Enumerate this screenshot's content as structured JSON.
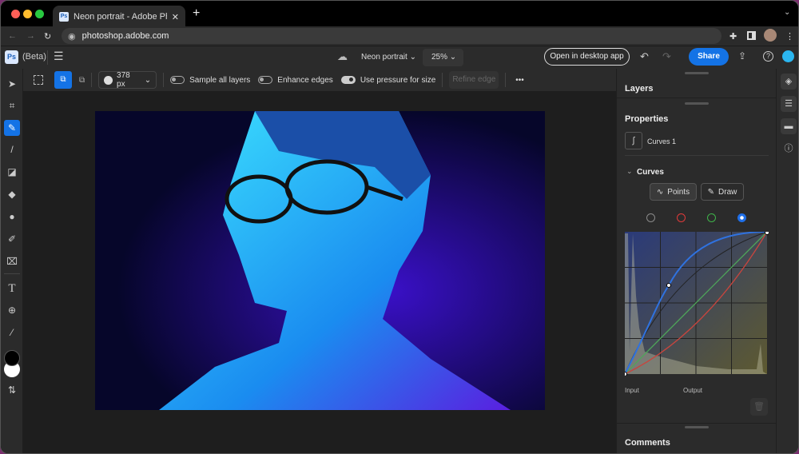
{
  "browser": {
    "tab_title": "Neon portrait - Adobe Photosh",
    "url": "photoshop.adobe.com",
    "new_tab": "+",
    "close": "✕"
  },
  "app": {
    "logo": "Ps",
    "beta": "(Beta)",
    "doc_name": "Neon portrait",
    "zoom": "25%",
    "open_desktop": "Open in desktop app",
    "share": "Share"
  },
  "options": {
    "brush_size": "378 px",
    "sample_all_layers": "Sample all layers",
    "sample_all_layers_on": false,
    "enhance_edges": "Enhance edges",
    "enhance_edges_on": false,
    "use_pressure": "Use pressure for size",
    "use_pressure_on": true,
    "refine_edge": "Refine edge",
    "more": "•••"
  },
  "panel": {
    "layers": "Layers",
    "properties": "Properties",
    "layer_name": "Curves 1",
    "curves": "Curves",
    "points": "Points",
    "draw": "Draw",
    "input": "Input",
    "output": "Output",
    "comments": "Comments"
  },
  "channels": [
    {
      "name": "rgb",
      "color": "#8a8a8a"
    },
    {
      "name": "red",
      "color": "#e03a3a"
    },
    {
      "name": "green",
      "color": "#3fb54a"
    },
    {
      "name": "blue",
      "color": "#1f6fe8",
      "selected": true
    }
  ],
  "colors": {
    "accent": "#1473e6",
    "foreground": "#000000",
    "background": "#ffffff"
  }
}
